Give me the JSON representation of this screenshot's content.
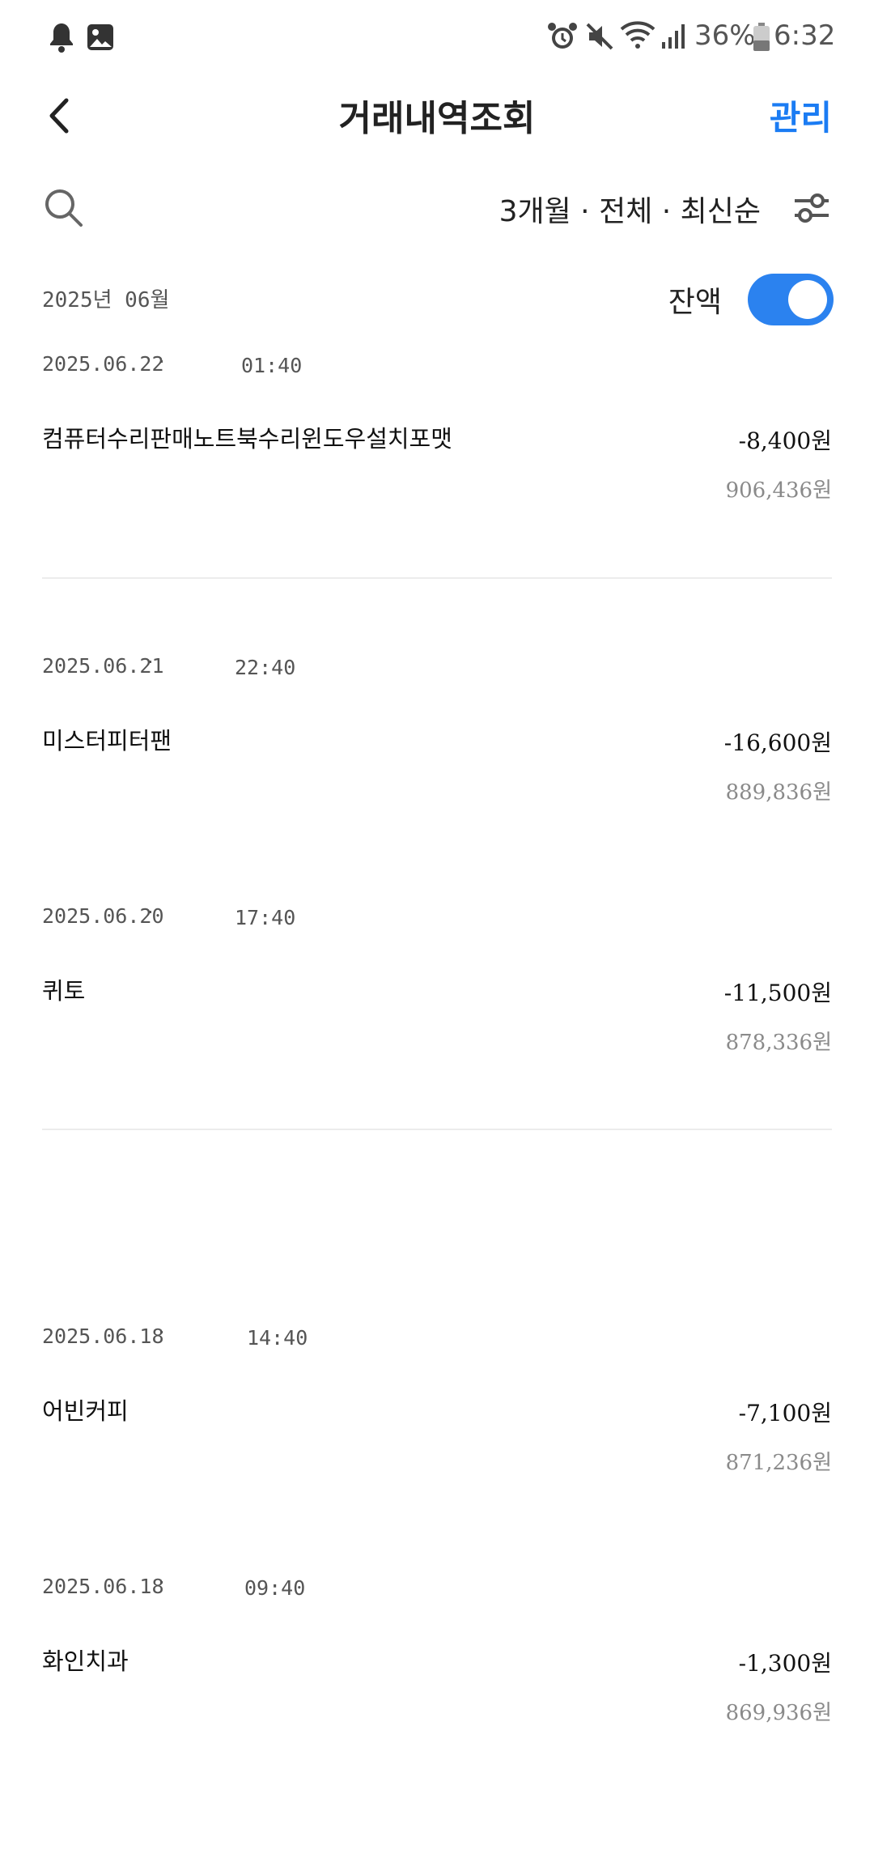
{
  "status_bar": {
    "battery": "36%",
    "time": "6:32",
    "icons": [
      "bell-icon",
      "image-icon",
      "alarm-icon",
      "mute-icon",
      "wifi-icon",
      "signal-icon",
      "battery-icon"
    ]
  },
  "header": {
    "title": "거래내역조회",
    "manage_label": "관리"
  },
  "filter": {
    "summary": "3개월 · 전체 · 최신순"
  },
  "month_label": "2025년 06월",
  "balance_toggle": {
    "label": "잔액",
    "on": true
  },
  "colors": {
    "accent": "#1b7cf3",
    "toggle": "#2b82ef",
    "divider": "#ececec"
  },
  "transactions": [
    {
      "date": "2025.06.22",
      "dot": "·",
      "time": "01:40",
      "name": "컴퓨터수리판매노트북수리윈도우설치포맷",
      "amount": "-8,400원",
      "balance": "906,436원"
    },
    {
      "date": "2025.06.21",
      "dot": "·",
      "time": "22:40",
      "name": "미스터피터팬",
      "amount": "-16,600원",
      "balance": "889,836원"
    },
    {
      "date": "2025.06.20",
      "dot": "·",
      "time": "17:40",
      "name": "퀴토",
      "amount": "-11,500원",
      "balance": "878,336원"
    },
    {
      "date": "2025.06.18",
      "dot": "·",
      "time": "14:40",
      "name": "어빈커피",
      "amount": "-7,100원",
      "balance": "871,236원"
    },
    {
      "date": "2025.06.18",
      "dot": "·",
      "time": "09:40",
      "name": "화인치과",
      "amount": "-1,300원",
      "balance": "869,936원"
    }
  ]
}
